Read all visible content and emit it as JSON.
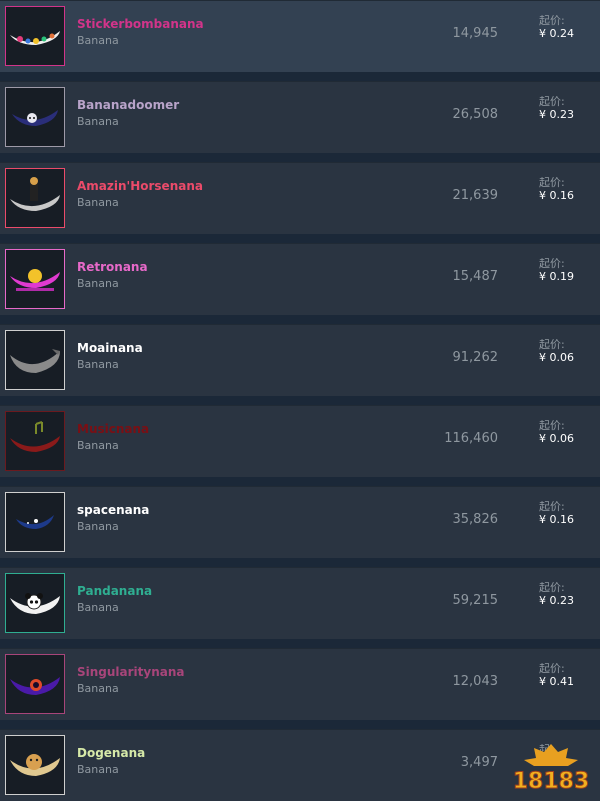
{
  "items": [
    {
      "name": "Stickerbombanana",
      "game": "Banana",
      "quantity": "14,945",
      "price_label": "起价:",
      "price": "¥ 0.24",
      "name_color": "#d2348a",
      "border_color": "#d2348a",
      "icon": "banana-sticker-icon"
    },
    {
      "name": "Bananadoomer",
      "game": "Banana",
      "quantity": "26,508",
      "price_label": "起价:",
      "price": "¥ 0.23",
      "name_color": "#b8a3c9",
      "border_color": "#9e9aa8",
      "icon": "banana-doomer-icon"
    },
    {
      "name": "Amazin'Horsenana",
      "game": "Banana",
      "quantity": "21,639",
      "price_label": "起价:",
      "price": "¥ 0.16",
      "name_color": "#eb4b6a",
      "border_color": "#eb4b6a",
      "icon": "banana-horse-icon"
    },
    {
      "name": "Retronana",
      "game": "Banana",
      "quantity": "15,487",
      "price_label": "起价:",
      "price": "¥ 0.19",
      "name_color": "#e769c9",
      "border_color": "#e769c9",
      "icon": "banana-retro-icon"
    },
    {
      "name": "Moainana",
      "game": "Banana",
      "quantity": "91,262",
      "price_label": "起价:",
      "price": "¥ 0.06",
      "name_color": "#ffffff",
      "border_color": "#cfcfcf",
      "icon": "banana-moai-icon"
    },
    {
      "name": "Musicnana",
      "game": "Banana",
      "quantity": "116,460",
      "price_label": "起价:",
      "price": "¥ 0.06",
      "name_color": "#7a0f14",
      "border_color": "#6b1a1f",
      "icon": "banana-music-icon"
    },
    {
      "name": "spacenana",
      "game": "Banana",
      "quantity": "35,826",
      "price_label": "起价:",
      "price": "¥ 0.16",
      "name_color": "#ffffff",
      "border_color": "#cfcfcf",
      "icon": "banana-space-icon"
    },
    {
      "name": "Pandanana",
      "game": "Banana",
      "quantity": "59,215",
      "price_label": "起价:",
      "price": "¥ 0.23",
      "name_color": "#2fae91",
      "border_color": "#2fae91",
      "icon": "banana-panda-icon"
    },
    {
      "name": "Singularitynana",
      "game": "Banana",
      "quantity": "12,043",
      "price_label": "起价:",
      "price": "¥ 0.41",
      "name_color": "#a8457a",
      "border_color": "#a8457a",
      "icon": "banana-singularity-icon"
    },
    {
      "name": "Dogenana",
      "game": "Banana",
      "quantity": "3,497",
      "price_label": "起",
      "price": "",
      "name_color": "#d6e9a8",
      "border_color": "#cfcfcf",
      "icon": "banana-doge-icon"
    }
  ],
  "watermark": {
    "text": "18183"
  }
}
